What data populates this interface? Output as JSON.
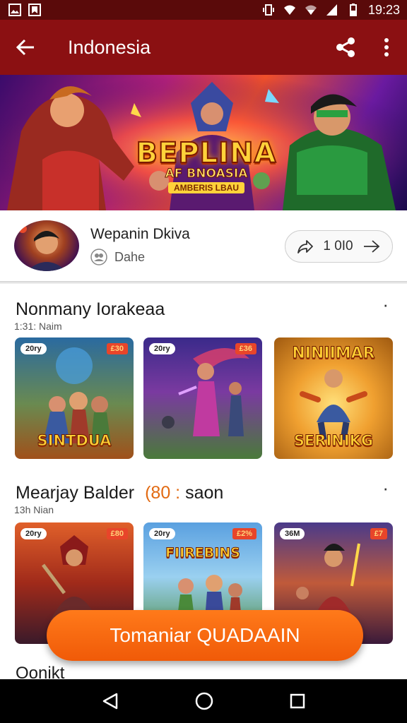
{
  "status_bar": {
    "time": "19:23"
  },
  "app_bar": {
    "title": "Indonesia"
  },
  "banner": {
    "title": "BEPLINA",
    "subtitle": "AF BNOASIA",
    "tagline": "AMBERIS LBAU"
  },
  "profile": {
    "name": "Wepanin Dkiva",
    "subtitle": "Dahe",
    "stat": "1 0I0"
  },
  "sections": [
    {
      "title": "Nonmany Iorakeaa",
      "caption": "1:31: Naim",
      "cards": [
        {
          "badge_left": "20ry",
          "badge_right": "£30",
          "label": "SINTDUA"
        },
        {
          "badge_left": "20ry",
          "badge_right": "£36",
          "label": ""
        },
        {
          "badge_left": "",
          "badge_right": "",
          "label_top": "NINIIMAR",
          "label": "SERINIKG"
        }
      ]
    },
    {
      "title": "Mearjay Balder",
      "accent": "(80 : ",
      "title_tail": "saon",
      "caption": "13h Nian",
      "cards": [
        {
          "badge_left": "20ry",
          "badge_right": "£80",
          "label": ""
        },
        {
          "badge_left": "20ry",
          "badge_right": "£2%",
          "label_top": "FIIREBINS",
          "label": ""
        },
        {
          "badge_left": "36M",
          "badge_right": "£7",
          "label": ""
        }
      ]
    }
  ],
  "cta": {
    "label": "Tomaniar QUADAAIN"
  },
  "bottom_section": {
    "title": "Oonikt"
  },
  "colors": {
    "app_bar": "#8b1012",
    "status_bar": "#5a0a0a",
    "cta": "#f26a10",
    "accent": "#e26a12"
  }
}
